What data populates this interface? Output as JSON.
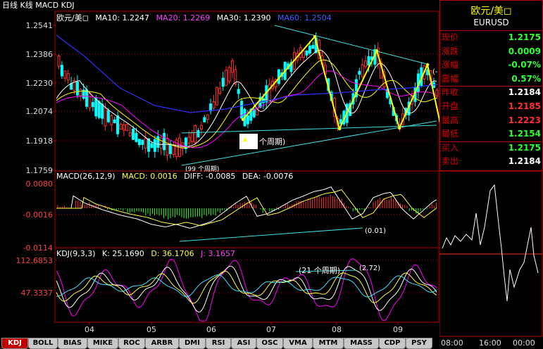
{
  "header": {
    "title": "日线 K线 MACD KDJ"
  },
  "main_legend": {
    "name": "欧元/美◻",
    "ma10": "MA10: 1.2247",
    "ma20": "MA20: 1.2269",
    "ma30": "MA30: 1.2390",
    "ma60": "MA60: 1.2504"
  },
  "macd_legend": {
    "name": "MACD(26,12,9)",
    "macd": "MACD: 0.0016",
    "diff": "DIFF: -0.0085",
    "dea": "DEA: -0.0076"
  },
  "kdj_legend": {
    "name": "KDJ(9,3,3)",
    "k": "K: 25.1690",
    "d": "D: 36.1706",
    "j": "J: 3.1657"
  },
  "annotations": {
    "a1": "个周期)",
    "a2": "(99 个周期)",
    "a3": "(0.01)",
    "a4": "(21 个周期)",
    "a5": "(2.72)",
    "a6": "(-"
  },
  "colors": {
    "up": "#ff3030",
    "down": "#00ffff",
    "ma10": "#ffffff",
    "ma20": "#ffff00",
    "ma30": "#ff00ff",
    "ma60": "#3030ff",
    "wave": "#ffff00",
    "trend": "#40e0e0",
    "grid": "#b00000"
  },
  "quote": {
    "title": "欧元/美◻",
    "symbol": "EURUSD",
    "rows": [
      {
        "k": "现价",
        "v": "1.2175",
        "c": "#30ff30"
      },
      {
        "k": "涨跌",
        "v": "0.0009",
        "c": "#30ff30"
      },
      {
        "k": "涨幅",
        "v": "-0.07%",
        "c": "#30ff30"
      },
      {
        "k": "震幅",
        "v": "0.57%",
        "c": "#30ff30"
      },
      {
        "k": "昨收",
        "v": "1.2184",
        "c": "#ffffff"
      },
      {
        "k": "开盘",
        "v": "1.2185",
        "c": "#ff3030"
      },
      {
        "k": "最高",
        "v": "1.2223",
        "c": "#ff3030"
      },
      {
        "k": "最低",
        "v": "1.2154",
        "c": "#30ff30"
      },
      {
        "k": "买入",
        "v": "1.2175",
        "c": "#30ff30"
      },
      {
        "k": "卖出",
        "v": "1.2184",
        "c": "#ffffff"
      }
    ],
    "intraday_times": [
      "08:00",
      "16:00",
      "00:00"
    ]
  },
  "tabs": [
    "KDJ",
    "BOLL",
    "BIAS",
    "MIKE",
    "ROC",
    "ARBR",
    "DMI",
    "RSI",
    "ASI",
    "OSC",
    "VMA",
    "MTM",
    "MASS",
    "CDP",
    "PSY"
  ],
  "chart_data": [
    {
      "type": "candlestick",
      "title": "欧元/美◻",
      "yticks": [
        "1.2541",
        "1.2386",
        "1.2230",
        "1.2074",
        "1.1918",
        "1.1759"
      ],
      "ylim": [
        1.1759,
        1.2541
      ],
      "xticks": [
        "04",
        "05",
        "06",
        "07",
        "08",
        "09"
      ],
      "series": [
        {
          "name": "MA10",
          "last": 1.2247
        },
        {
          "name": "MA20",
          "last": 1.2269
        },
        {
          "name": "MA30",
          "last": 1.239
        },
        {
          "name": "MA60",
          "last": 1.2504
        }
      ]
    },
    {
      "type": "bar",
      "title": "MACD(26,12,9)",
      "yticks": [
        "0.0080",
        "-0.0016",
        "-0.0114"
      ],
      "ylim": [
        -0.0114,
        0.008
      ],
      "series": [
        {
          "name": "DIFF",
          "last": -0.0085
        },
        {
          "name": "DEA",
          "last": -0.0076
        },
        {
          "name": "MACD",
          "last": 0.0016
        }
      ]
    },
    {
      "type": "line",
      "title": "KDJ(9,3,3)",
      "yticks": [
        "112.6853",
        "47.3337"
      ],
      "ylim": [
        -20,
        112.6853
      ],
      "series": [
        {
          "name": "K",
          "last": 25.169
        },
        {
          "name": "D",
          "last": 36.1706
        },
        {
          "name": "J",
          "last": 3.1657
        }
      ]
    }
  ]
}
